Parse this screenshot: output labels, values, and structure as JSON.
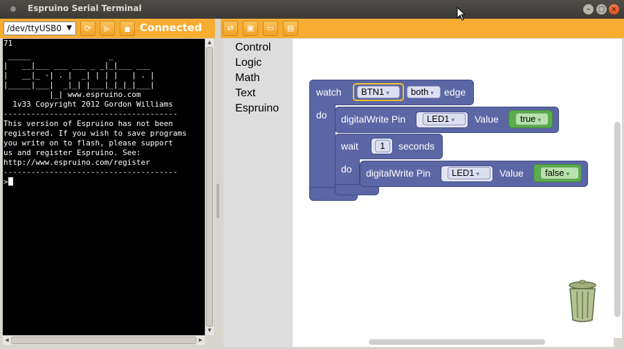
{
  "window": {
    "title": "Espruino Serial Terminal",
    "controls": {
      "minimize": "–",
      "maximize": "□",
      "close": "×"
    }
  },
  "left_toolbar": {
    "port": "/dev/ttyUSB0",
    "port_arrow": "▼",
    "refresh_icon": "⟳",
    "play_icon": "▶",
    "stop_icon": "■",
    "status": "Connected"
  },
  "terminal": {
    "lines": [
      "71",
      " _____                 _",
      "|   __|___ ___ ___ _ _|_|___ ___",
      "|   __|_ -| . |  _| | | |   | . |",
      "|_____|___|  _|_| |___|_|_|_|___|",
      "          |_| www.espruino.com",
      "  1v33 Copyright 2012 Gordon Williams",
      "--------------------------------------",
      "This version of Espruino has not been",
      "registered. If you wish to save programs",
      "you write on to flash, please support",
      "us and register Espruino. See:",
      "http://www.espruino.com/register",
      "--------------------------------------",
      ">"
    ]
  },
  "right_toolbar": {
    "icons": [
      "swap-icon",
      "image-icon",
      "folder-open-icon",
      "save-icon"
    ],
    "glyphs": [
      "⇄",
      "▣",
      "▭",
      "▤"
    ]
  },
  "toolbox": {
    "categories": [
      "Control",
      "Logic",
      "Math",
      "Text",
      "Espruino"
    ]
  },
  "blocks": {
    "watch": {
      "label": "watch",
      "pin": "BTN1",
      "edge_type": "both",
      "edge_label": "edge",
      "do_label": "do"
    },
    "write1": {
      "label": "digitalWrite Pin",
      "pin": "LED1",
      "value_label": "Value",
      "value": "true"
    },
    "wait": {
      "label": "wait",
      "amount": "1",
      "unit": "seconds",
      "do_label": "do"
    },
    "write2": {
      "label": "digitalWrite Pin",
      "pin": "LED1",
      "value_label": "Value",
      "value": "false"
    }
  },
  "dropdown_arrow": "▾",
  "colors": {
    "accent": "#f7ac32",
    "block": "#5b67a5",
    "bool_block": "#5bac4e",
    "highlight": "#f7c22b"
  }
}
